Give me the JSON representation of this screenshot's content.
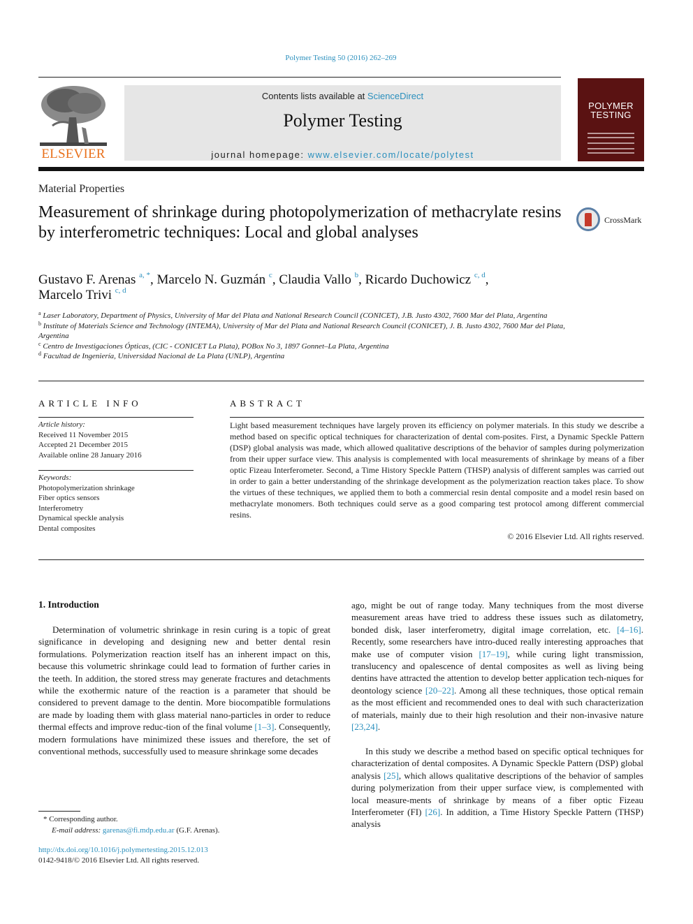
{
  "citation": "Polymer Testing 50 (2016) 262–269",
  "header": {
    "publisher_logo_word": "ELSEVIER",
    "contents_prefix": "Contents lists available at ",
    "contents_link": "ScienceDirect",
    "journal_name": "Polymer Testing",
    "homepage_prefix": "journal homepage: ",
    "homepage_link": "www.elsevier.com/locate/polytest",
    "cover_title_line1": "POLYMER",
    "cover_title_line2": "TESTING"
  },
  "article": {
    "section": "Material Properties",
    "title": "Measurement of shrinkage during photopolymerization of methacrylate resins by interferometric techniques: Local and global analyses",
    "crossmark_label": "CrossMark",
    "authors": [
      {
        "name": "Gustavo F. Arenas",
        "sup": "a, *",
        "sep": ", "
      },
      {
        "name": "Marcelo N. Guzmán",
        "sup": "c",
        "sep": ", "
      },
      {
        "name": "Claudia Vallo",
        "sup": "b",
        "sep": ", "
      },
      {
        "name": "Ricardo Duchowicz",
        "sup": "c, d",
        "sep": ","
      },
      {
        "name": "Marcelo Trivi",
        "sup": "c, d",
        "sep": ""
      }
    ],
    "affiliations": [
      {
        "key": "a",
        "text": "Laser Laboratory, Department of Physics, University of Mar del Plata and National Research Council (CONICET), J.B. Justo 4302, 7600 Mar del Plata, Argentina"
      },
      {
        "key": "b",
        "text": "Institute of Materials Science and Technology (INTEMA), University of Mar del Plata and National Research Council (CONICET), J. B. Justo 4302, 7600 Mar del Plata, Argentina"
      },
      {
        "key": "c",
        "text": "Centro de Investigaciones Ópticas, (CIC - CONICET La Plata), POBox No 3, 1897 Gonnet–La Plata, Argentina"
      },
      {
        "key": "d",
        "text": "Facultad de Ingeniería, Universidad Nacional de La Plata (UNLP), Argentina"
      }
    ]
  },
  "article_info": {
    "heading": "ARTICLE INFO",
    "history_label": "Article history:",
    "history": [
      "Received 11 November 2015",
      "Accepted 21 December 2015",
      "Available online 28 January 2016"
    ],
    "keywords_label": "Keywords:",
    "keywords": [
      "Photopolymerization shrinkage",
      "Fiber optics sensors",
      "Interferometry",
      "Dynamical speckle analysis",
      "Dental composites"
    ]
  },
  "abstract": {
    "heading": "ABSTRACT",
    "text": "Light based measurement techniques have largely proven its efficiency on polymer materials. In this study we describe a method based on specific optical techniques for characterization of dental com-posites. First, a Dynamic Speckle Pattern (DSP) global analysis was made, which allowed qualitative descriptions of the behavior of samples during polymerization from their upper surface view. This analysis is complemented with local measurements of shrinkage by means of a fiber optic Fizeau Interferometer. Second, a Time History Speckle Pattern (THSP) analysis of different samples was carried out in order to gain a better understanding of the shrinkage development as the polymerization reaction takes place. To show the virtues of these techniques, we applied them to both a commercial resin dental composite and a model resin based on methacrylate monomers. Both techniques could serve as a good comparing test protocol among different commercial resins.",
    "copyright": "© 2016 Elsevier Ltd. All rights reserved."
  },
  "body": {
    "intro_heading": "1.  Introduction",
    "left": [
      {
        "t": "Determination of volumetric shrinkage in resin curing is a topic of great significance in developing and designing new and better dental resin formulations. Polymerization reaction itself has an inherent impact on this, because this volumetric shrinkage could lead to formation of further caries in the teeth. In addition, the stored stress may generate fractures and detachments while the exothermic nature of the reaction is a parameter that should be considered to prevent damage to the dentin. More biocompatible formulations are made by loading them with glass material nano-particles in order to reduce thermal effects and improve reduc-tion of the final volume "
      },
      {
        "ref": "[1–3]"
      },
      {
        "t": ". Consequently, modern formulations have minimized these issues and therefore, the set of conventional methods, successfully used to measure shrinkage some decades"
      }
    ],
    "right_1": [
      {
        "t": "ago, might be out of range today. Many techniques from the most diverse measurement areas have tried to address these issues such as dilatometry, bonded disk, laser interferometry, digital image correlation, etc. "
      },
      {
        "ref": "[4–16]"
      },
      {
        "t": ". Recently, some researchers have intro-duced really interesting approaches that make use of computer vision "
      },
      {
        "ref": "[17–19]"
      },
      {
        "t": ", while curing light transmission, translucency and opalescence of dental composites as well as living being dentins have attracted the attention to develop better application tech-niques for deontology science "
      },
      {
        "ref": "[20–22]"
      },
      {
        "t": ". Among all these techniques, those optical remain as the most efficient and recommended ones to deal with such characterization of materials, mainly due to their high resolution and their non-invasive nature "
      },
      {
        "ref": "[23,24]"
      },
      {
        "t": "."
      }
    ],
    "right_2": [
      {
        "t": "In this study we describe a method based on specific optical techniques for characterization of dental composites. A Dynamic Speckle Pattern (DSP) global analysis "
      },
      {
        "ref": "[25]"
      },
      {
        "t": ", which allows qualitative descriptions of the behavior of samples during polymerization from their upper surface view, is complemented with local measure-ments of shrinkage by means of a fiber optic Fizeau Interferometer (FI) "
      },
      {
        "ref": "[26]"
      },
      {
        "t": ". In addition, a Time History Speckle Pattern (THSP) analysis"
      }
    ]
  },
  "footnotes": {
    "corresponding": "* Corresponding author.",
    "email_label": "E-mail address: ",
    "email": "garenas@fi.mdp.edu.ar",
    "email_owner": " (G.F. Arenas).",
    "doi": "http://dx.doi.org/10.1016/j.polymertesting.2015.12.013",
    "issn": "0142-9418/© 2016 Elsevier Ltd. All rights reserved."
  }
}
